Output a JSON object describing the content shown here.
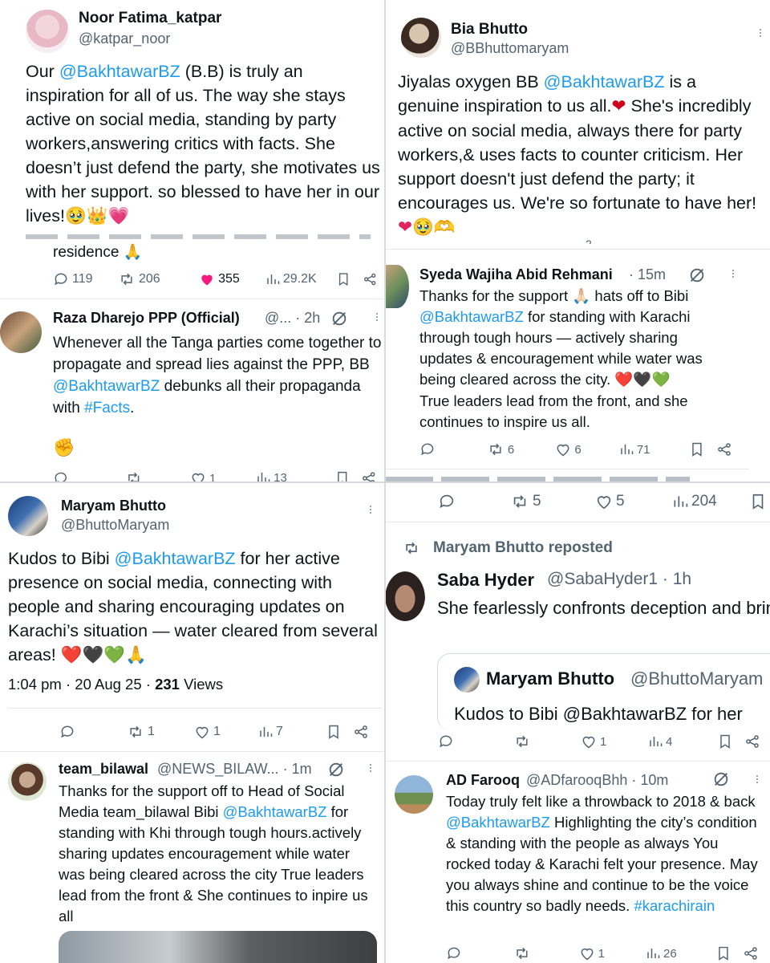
{
  "colors": {
    "link": "#1d9bf0",
    "text": "#0f1419",
    "muted": "#536471",
    "like_active": "#f91880",
    "divider": "#e6e8eb"
  },
  "p1": {
    "name": "Noor Fatima_katpar",
    "handle": "@katpar_noor",
    "text_a": "Our ",
    "mention": "@BakhtawarBZ",
    "text_b": " (B.B) is truly an inspiration for all of us. The way she stays active on social media, standing by party workers,answering critics with facts. She doesn’t just defend the party, she motivates us with her support. so blessed to have her in our lives!",
    "emojis": "🥹👑💗",
    "residence": "residence 🙏",
    "replies": "119",
    "reposts": "206",
    "likes": "355",
    "views": "29.2K",
    "icons": [
      "reply-icon",
      "repost-icon",
      "heart-icon",
      "views-icon",
      "bookmark-icon",
      "share-icon"
    ]
  },
  "p1b": {
    "name": "Raza Dharejo PPP (Official)",
    "handle_time": "@... · 2h",
    "text_a": "Whenever all the Tanga parties come together to propagate and spread lies against the PPP, BB ",
    "mention": "@BakhtawarBZ",
    "text_b": " debunks all their propaganda with ",
    "hashtag": "#Facts",
    "text_c": ".",
    "fist": "✊",
    "cut_replies": "1",
    "cut_views": "13"
  },
  "p2": {
    "name": "Bia Bhutto",
    "handle": "@BBhuttomaryam",
    "text_a": "Jiyalas oxygen BB ",
    "mention": "@BakhtawarBZ",
    "text_b": " is a genuine inspiration to us all.",
    "emoji_a": "❤",
    "text_c": " She's incredibly active on social media, always there for party workers,& uses facts to counter criticism. Her support doesn't just defend the party; it encourages us. We're so fortunate to have her! ",
    "emoji_b": "❤🥹🫶",
    "cut_count": "2"
  },
  "p2b": {
    "name": "Syeda Wajiha Abid Rehmani",
    "time": "· 15m",
    "text_a": "Thanks for the support 🙏🏻 hats off to Bibi ",
    "mention": "@BakhtawarBZ",
    "text_b": " for standing with Karachi through tough hours — actively sharing updates & encouragement while water was being cleared across the city. ",
    "hearts": "❤️🖤💚",
    "text_c": "True leaders lead from the front, and she continues to inspire us all.",
    "reposts": "6",
    "likes": "6",
    "views": "71"
  },
  "p3": {
    "name": "Maryam Bhutto",
    "handle": "@BhuttoMaryam",
    "text_a": "Kudos to Bibi ",
    "mention": "@BakhtawarBZ",
    "text_b": " for her active presence on social media, connecting with people and sharing encouraging updates on Karachi’s situation — water cleared from several areas! ",
    "emojis": "❤️🖤💚🙏",
    "timestamp": "1:04 pm · 20 Aug 25 · ",
    "views_count": "231",
    "views_label": " Views",
    "reposts": "1",
    "likes": "1",
    "views": "7"
  },
  "p3b": {
    "name": "team_bilawal",
    "handle_time": "@NEWS_BILAW... · 1m",
    "text_a": "Thanks for the support off to Head of Social Media team_bilawal  Bibi ",
    "mention": "@BakhtawarBZ",
    "text_b": " for standing with Khi through tough hours.actively sharing updates encouragement while water was being cleared across the city True leaders lead from the front & She continues to inpire us all"
  },
  "p4": {
    "reposts": "5",
    "likes": "5",
    "views": "204",
    "repost_label": "Maryam Bhutto reposted",
    "name": "Saba Hyder",
    "handle_time": "@SabaHyder1 · 1h",
    "text": "She fearlessly confronts deception and brings liars to light.",
    "emojis": "🫰🏻😭",
    "quote_name": "Maryam Bhutto",
    "quote_handle": "@BhuttoMaryam",
    "quote_text": "Kudos to Bibi @BakhtawarBZ for her",
    "q_likes": "1",
    "q_views": "4"
  },
  "p4b": {
    "name": "AD Farooq",
    "handle_time": "@ADfarooqBhh · 10m",
    "text_a": "Today truly felt like a throwback to 2018 & back ",
    "mention": "@BakhtawarBZ",
    "text_b": "  Highlighting the city’s condition & standing with the people as always You rocked today & Karachi felt your presence. May you always shine and continue to be the voice this country so badly needs. ",
    "hashtag": "#karachirain",
    "likes": "1",
    "views": "26"
  }
}
